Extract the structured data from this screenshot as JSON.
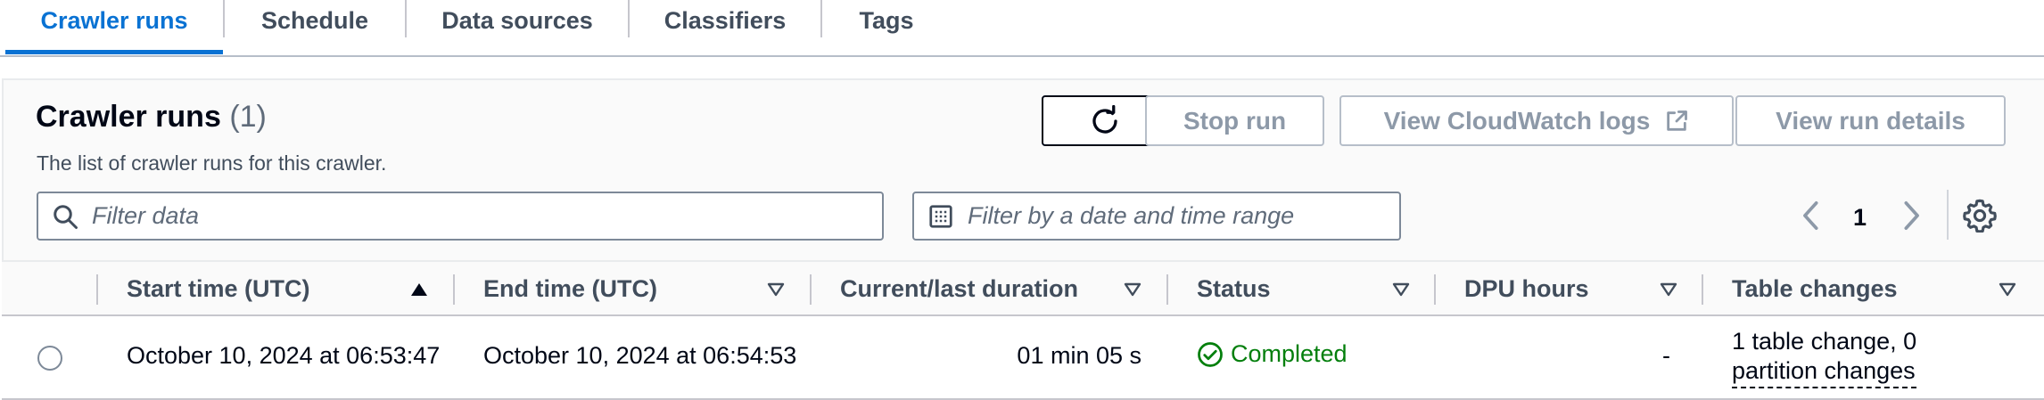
{
  "tabs": [
    {
      "label": "Crawler runs",
      "active": true
    },
    {
      "label": "Schedule",
      "active": false
    },
    {
      "label": "Data sources",
      "active": false
    },
    {
      "label": "Classifiers",
      "active": false
    },
    {
      "label": "Tags",
      "active": false
    }
  ],
  "panel": {
    "title": "Crawler runs",
    "count": "(1)",
    "description": "The list of crawler runs for this crawler."
  },
  "actions": {
    "refresh_icon": "refresh-icon",
    "stop_run": "Stop run",
    "view_cloudwatch_logs": "View CloudWatch logs",
    "external_icon": "external-link-icon",
    "view_run_details": "View run details"
  },
  "filters": {
    "search_placeholder": "Filter data",
    "date_placeholder": "Filter by a date and time range"
  },
  "pagination": {
    "current_page": "1"
  },
  "table": {
    "columns": [
      {
        "label": "Start time (UTC)",
        "sort": "ascending"
      },
      {
        "label": "End time (UTC)",
        "sort": "none"
      },
      {
        "label": "Current/last duration",
        "sort": "none"
      },
      {
        "label": "Status",
        "sort": "none"
      },
      {
        "label": "DPU hours",
        "sort": "none"
      },
      {
        "label": "Table changes",
        "sort": "none"
      }
    ],
    "rows": [
      {
        "start_time": "October 10, 2024 at 06:53:47",
        "end_time": "October 10, 2024 at 06:54:53",
        "duration": "01 min 05 s",
        "status": "Completed",
        "dpu_hours": "-",
        "table_changes_line1": "1 table change, 0",
        "table_changes_line2": "partition changes"
      }
    ]
  },
  "colors": {
    "accent": "#0972d3",
    "success": "#037f0c",
    "disabled_text": "#8d99a8"
  }
}
